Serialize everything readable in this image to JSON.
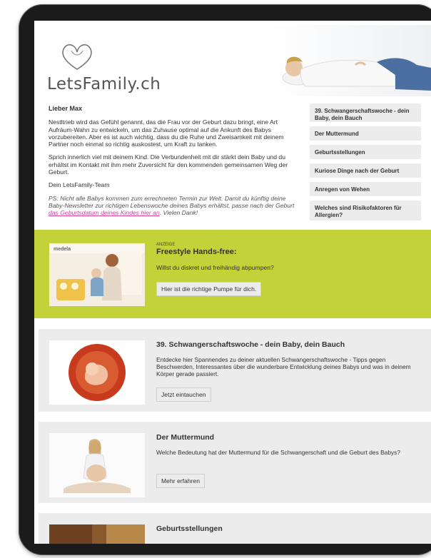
{
  "brand": {
    "name": "LetsFamily.ch"
  },
  "intro": {
    "greeting": "Lieber Max",
    "p1": "Nestltrieb wird das Gefühl genannt, das die Frau vor der Geburt dazu bringt, eine Art Aufräum-Wahn zu entwickeln, um das Zuhause optimal auf die Ankunft des Babys vorzubereiten. Aber es ist auch wichtig, dass du die Ruhe und Zweisamkeit mit deinem Partner noch einmal so richtig auskostest, um Kraft zu tanken.",
    "p2": "Sprich innerlich viel mit deinem Kind. Die Verbundenheit mit dir stärkt dein Baby und du erhältst im Kontakt mit ihm mehr Zuversicht für den kommenden gemeinsamen Weg der Geburt.",
    "signature": "Dein LetsFamily-Team",
    "ps_text": "PS: Nicht alle Babys kommen zum errechneten Termin zur Welt. Damit du künftig deine Baby-Newsletter zur richtigen Lebenswoche deines Babys erhältst, passe nach der Geburt",
    "ps_link": "das Geburtsdatum deines Kindes hier an",
    "ps_end": ". Vielen Dank!"
  },
  "sidebar": {
    "items": [
      {
        "label": "39. Schwangerschaftswoche - dein Baby, dein Bauch"
      },
      {
        "label": "Der Muttermund"
      },
      {
        "label": "Geburtsstellungen"
      },
      {
        "label": "Kuriose Dinge nach der Geburt"
      },
      {
        "label": "Anregen von Wehen"
      },
      {
        "label": "Welches sind Risikofaktoren für Allergien?"
      }
    ]
  },
  "ad": {
    "tag": "ANZEIGE",
    "title": "Freestyle Hands-free:",
    "text": "Willst du diskret und freihändig abpumpen?",
    "button": "Hier ist die richtige Pumpe für dich.",
    "brand_mark": "medela"
  },
  "cards": [
    {
      "title": "39. Schwangerschaftswoche - dein Baby, dein Bauch",
      "text": "Entdecke hier Spannendes zu deiner aktuellen Schwangerschaftswoche - Tipps gegen Beschwerden, Interessantes über die wunderbare Entwicklung deines Babys und was in deinem Körper gerade passiert.",
      "button": "Jetzt eintauchen"
    },
    {
      "title": "Der Muttermund",
      "text": "Welche Bedeutung hat der Muttermund für die Schwangerschaft und die Geburt des Babys?",
      "button": "Mehr erfahren"
    },
    {
      "title": "Geburtsstellungen"
    }
  ],
  "colors": {
    "ad_background": "#c3d239",
    "card_background": "#ececec",
    "link": "#d43fa0"
  }
}
